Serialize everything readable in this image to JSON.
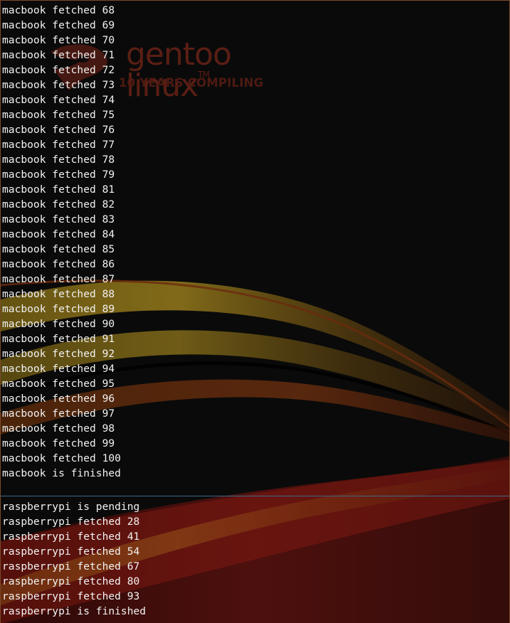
{
  "wallpaper": {
    "logo_name": "gentoo linux",
    "logo_trademark": "TM",
    "logo_tagline": "10 YEARS COMPILING"
  },
  "top_pane": {
    "lines": [
      "macbook fetched 68",
      "macbook fetched 69",
      "macbook fetched 70",
      "macbook fetched 71",
      "macbook fetched 72",
      "macbook fetched 73",
      "macbook fetched 74",
      "macbook fetched 75",
      "macbook fetched 76",
      "macbook fetched 77",
      "macbook fetched 78",
      "macbook fetched 79",
      "macbook fetched 81",
      "macbook fetched 82",
      "macbook fetched 83",
      "macbook fetched 84",
      "macbook fetched 85",
      "macbook fetched 86",
      "macbook fetched 87",
      "macbook fetched 88",
      "macbook fetched 89",
      "macbook fetched 90",
      "macbook fetched 91",
      "macbook fetched 92",
      "macbook fetched 94",
      "macbook fetched 95",
      "macbook fetched 96",
      "macbook fetched 97",
      "macbook fetched 98",
      "macbook fetched 99",
      "macbook fetched 100",
      "macbook is finished"
    ]
  },
  "bottom_pane": {
    "lines": [
      "raspberrypi is pending",
      "raspberrypi fetched 28",
      "raspberrypi fetched 41",
      "raspberrypi fetched 54",
      "raspberrypi fetched 67",
      "raspberrypi fetched 80",
      "raspberrypi fetched 93",
      "raspberrypi is finished"
    ]
  },
  "colors": {
    "background": "#0a0a0a",
    "text": "#f2f2f2",
    "divider": "#3d6b8c",
    "swoosh_gold": "#c9a227",
    "swoosh_red": "#8a1a12",
    "logo": "#5a1e14"
  }
}
